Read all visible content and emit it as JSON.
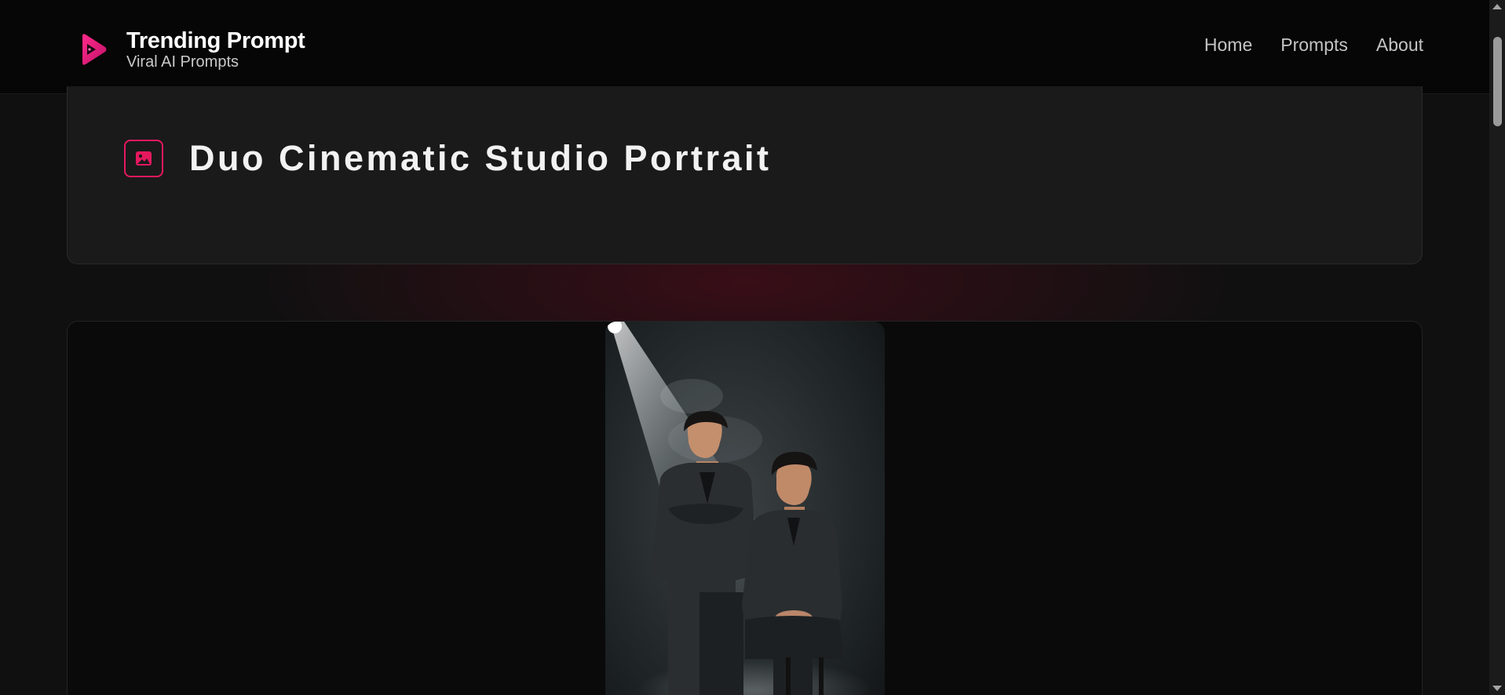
{
  "brand": {
    "title": "Trending Prompt",
    "subtitle": "Viral AI Prompts",
    "accent": "#e6185e"
  },
  "nav": {
    "items": [
      "Home",
      "Prompts",
      "About"
    ]
  },
  "prompt": {
    "title": "Duo Cinematic Studio Portrait",
    "icon": "image-icon"
  },
  "scrollbar": {
    "present": true
  }
}
